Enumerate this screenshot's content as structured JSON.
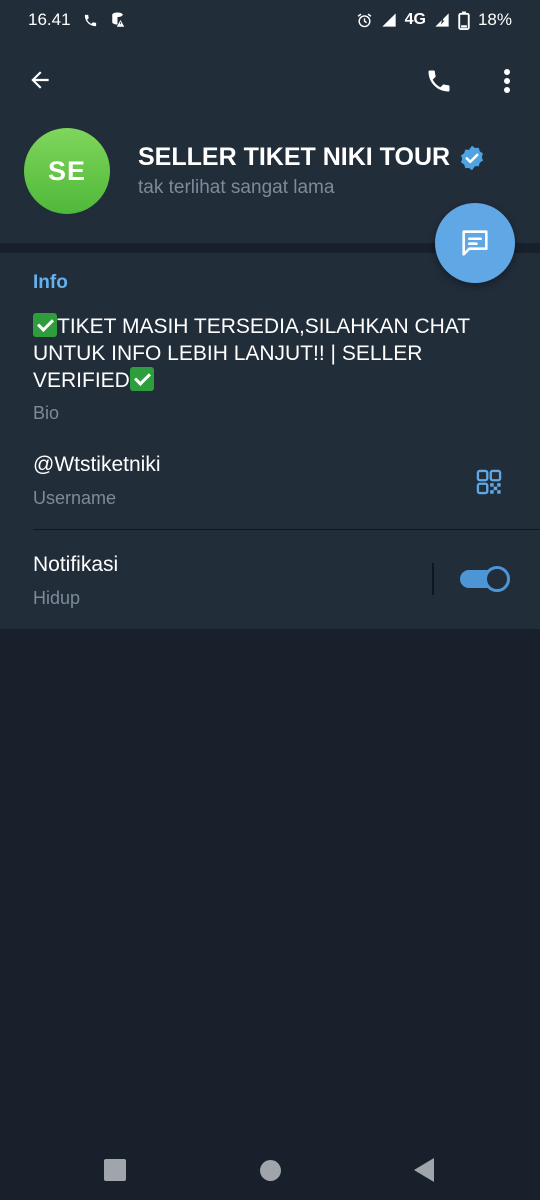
{
  "status_bar": {
    "time": "16.41",
    "network": "4G",
    "battery": "18%"
  },
  "header": {
    "avatar_initials": "SE",
    "name": "SELLER TIKET NIKI TOUR",
    "last_seen": "tak terlihat sangat lama"
  },
  "info": {
    "section_title": "Info",
    "bio": "TIKET MASIH TERSEDIA,SILAHKAN CHAT UNTUK INFO LEBIH LANJUT!! | SELLER VERIFIED",
    "bio_label": "Bio",
    "username": "@Wtstiketniki",
    "username_label": "Username",
    "notifications_title": "Notifikasi",
    "notifications_status": "Hidup"
  },
  "colors": {
    "accent": "#5fa8e5",
    "header_bg": "#222d3a",
    "page_bg": "#18202b",
    "avatar_green": "#4fb83a"
  },
  "icons": {
    "back": "arrow-left-icon",
    "call": "phone-icon",
    "more": "more-vertical-icon",
    "verified": "verified-badge-icon",
    "fab": "message-icon",
    "qr": "qr-code-icon"
  }
}
